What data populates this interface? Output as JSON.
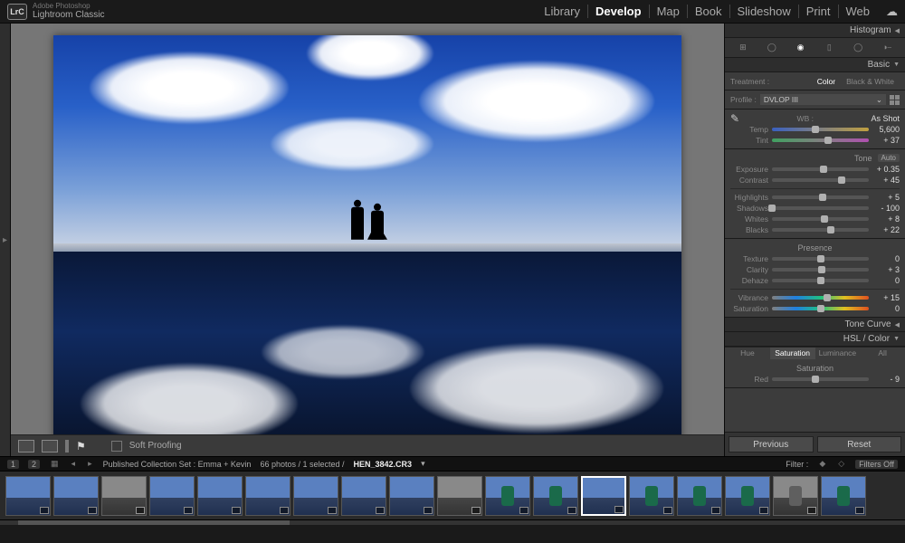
{
  "app": {
    "vendor": "Adobe Photoshop",
    "name": "Lightroom Classic",
    "logo": "LrC"
  },
  "modules": [
    "Library",
    "Develop",
    "Map",
    "Book",
    "Slideshow",
    "Print",
    "Web"
  ],
  "active_module": "Develop",
  "toolbar": {
    "soft_proofing": "Soft Proofing"
  },
  "right": {
    "histogram": "Histogram",
    "basic": {
      "title": "Basic",
      "treatment_label": "Treatment :",
      "treatment_opts": [
        "Color",
        "Black & White"
      ],
      "treatment_active": "Color",
      "profile_label": "Profile :",
      "profile_value": "DVLOP III",
      "wb_label": "WB :",
      "wb_value": "As Shot",
      "temp": {
        "label": "Temp",
        "value": "5,600"
      },
      "tint": {
        "label": "Tint",
        "value": "+ 37"
      },
      "tone_header": "Tone",
      "auto_label": "Auto",
      "exposure": {
        "label": "Exposure",
        "value": "+ 0.35"
      },
      "contrast": {
        "label": "Contrast",
        "value": "+ 45"
      },
      "highlights": {
        "label": "Highlights",
        "value": "+ 5"
      },
      "shadows": {
        "label": "Shadows",
        "value": "- 100"
      },
      "whites": {
        "label": "Whites",
        "value": "+ 8"
      },
      "blacks": {
        "label": "Blacks",
        "value": "+ 22"
      },
      "presence_header": "Presence",
      "texture": {
        "label": "Texture",
        "value": "0"
      },
      "clarity": {
        "label": "Clarity",
        "value": "+ 3"
      },
      "dehaze": {
        "label": "Dehaze",
        "value": "0"
      },
      "vibrance": {
        "label": "Vibrance",
        "value": "+ 15"
      },
      "saturation": {
        "label": "Saturation",
        "value": "0"
      }
    },
    "tone_curve": "Tone Curve",
    "hsl": {
      "title": "HSL / Color",
      "tabs": [
        "Hue",
        "Saturation",
        "Luminance",
        "All"
      ],
      "active": "Saturation",
      "sub": "Saturation",
      "red": {
        "label": "Red",
        "value": "- 9"
      }
    },
    "buttons": {
      "previous": "Previous",
      "reset": "Reset"
    }
  },
  "info": {
    "pages": [
      "1",
      "2"
    ],
    "collection": "Published Collection Set : Emma + Kevin",
    "counts": "66 photos / 1 selected /",
    "filename": "HEN_3842.CR3",
    "filter_label": "Filter :",
    "filters_off": "Filters Off"
  },
  "filmstrip": {
    "count": 18,
    "selected_index": 12
  }
}
